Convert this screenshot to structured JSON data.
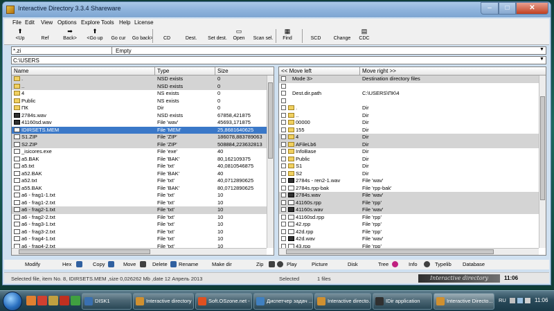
{
  "window": {
    "title": "Interactive Directory 3.3.4 Shareware",
    "min_glyph": "–",
    "max_glyph": "□",
    "close_glyph": "✕"
  },
  "menu": [
    "File",
    "Edit",
    "View",
    "Options",
    "Explore",
    "Tools",
    "Help",
    "License"
  ],
  "toolbar": {
    "buttons": [
      {
        "label": "<Up",
        "icon": "up-arrow-icon",
        "glyph": "⬆"
      },
      {
        "label": "Ref",
        "icon": "refresh-icon",
        "glyph": ""
      },
      {
        "label": "Back>",
        "icon": "back-arrow-icon",
        "glyph": "➡"
      },
      {
        "label": "<Go up",
        "icon": "go-up-arrow-icon",
        "glyph": "⬆"
      },
      {
        "label": "Go cur",
        "icon": "go-current-icon",
        "glyph": ""
      },
      {
        "label": "Go back>",
        "icon": "go-back-icon",
        "glyph": ""
      },
      {
        "label": "CD",
        "icon": "cd-icon",
        "glyph": ""
      },
      {
        "label": "Dest.",
        "icon": "destination-icon",
        "glyph": ""
      },
      {
        "label": "Set dest.",
        "icon": "set-destination-icon",
        "glyph": ""
      },
      {
        "label": "Open",
        "icon": "open-icon",
        "glyph": "▭"
      },
      {
        "label": "Scan sel.",
        "icon": "scan-icon",
        "glyph": ""
      },
      {
        "label": "Find",
        "icon": "find-icon",
        "glyph": "▦"
      },
      {
        "label": "SCD",
        "icon": "scd-icon",
        "glyph": ""
      },
      {
        "label": "Change",
        "icon": "change-icon",
        "glyph": ""
      },
      {
        "label": "CDC",
        "icon": "cdc-icon",
        "glyph": "▤"
      }
    ]
  },
  "mask": {
    "value": "*.zi",
    "status": "Empty",
    "dropdown_glyph": "▼"
  },
  "path": {
    "value": "C:\\USERS",
    "dropdown_glyph": "▼"
  },
  "left_panel": {
    "headers": {
      "name": "Name",
      "type": "Type",
      "size": "Size"
    },
    "rows": [
      {
        "name": ".",
        "type": "NSD exists",
        "size": "0",
        "icon": "folder",
        "style": "gray"
      },
      {
        "name": "..",
        "type": "NSD exists",
        "size": "0",
        "icon": "folder",
        "style": "gray"
      },
      {
        "name": "4",
        "type": "NS exists",
        "size": "0",
        "icon": "folder",
        "style": "white"
      },
      {
        "name": "Public",
        "type": "NS exists",
        "size": "0",
        "icon": "folder",
        "style": "white"
      },
      {
        "name": "ПК",
        "type": "Dir",
        "size": "0",
        "icon": "folder",
        "style": "white"
      },
      {
        "name": "2784s.wav",
        "type": "NSD exists",
        "size": "67858,421875",
        "icon": "wav",
        "style": "white"
      },
      {
        "name": "41160sd.wav",
        "type": "File 'wav'",
        "size": "45693,171875",
        "icon": "wav",
        "style": "white"
      },
      {
        "name": "IDIRSETS.MEM",
        "type": "File 'MEM'",
        "size": "25,8681640625",
        "icon": "file",
        "style": "sel"
      },
      {
        "name": "S1.ZIP",
        "type": "File 'ZIP'",
        "size": "186078,883789063",
        "icon": "file",
        "style": "gray"
      },
      {
        "name": "S2.ZIP",
        "type": "File 'ZIP'",
        "size": "508884,223632813",
        "icon": "file",
        "style": "gray"
      },
      {
        "name": "_isicores.exe",
        "type": "File 'exe'",
        "size": "40",
        "icon": "file",
        "style": "white"
      },
      {
        "name": "a5.BAK",
        "type": "File 'BAK'",
        "size": "80,162109375",
        "icon": "file",
        "style": "white"
      },
      {
        "name": "a5.txt",
        "type": "File 'txt'",
        "size": "40,0810546875",
        "icon": "file",
        "style": "white"
      },
      {
        "name": "a52.BAK",
        "type": "File 'BAK'",
        "size": "40",
        "icon": "file",
        "style": "white"
      },
      {
        "name": "a52.txt",
        "type": "File 'txt'",
        "size": "40,0712890625",
        "icon": "file",
        "style": "white"
      },
      {
        "name": "a55.BAK",
        "type": "File 'BAK'",
        "size": "80,0712890625",
        "icon": "file",
        "style": "white"
      },
      {
        "name": "a6 - frag1-1.txt",
        "type": "File 'txt'",
        "size": "10",
        "icon": "file",
        "style": "white"
      },
      {
        "name": "a6 - frag1-2.txt",
        "type": "File 'txt'",
        "size": "10",
        "icon": "file",
        "style": "white"
      },
      {
        "name": "a6 - frag2-1.txt",
        "type": "File 'txt'",
        "size": "10",
        "icon": "file",
        "style": "gray"
      },
      {
        "name": "a6 - frag2-2.txt",
        "type": "File 'txt'",
        "size": "10",
        "icon": "file",
        "style": "white"
      },
      {
        "name": "a6 - frag3-1.txt",
        "type": "File 'txt'",
        "size": "10",
        "icon": "file",
        "style": "white"
      },
      {
        "name": "a6 - frag3-2.txt",
        "type": "File 'txt'",
        "size": "10",
        "icon": "file",
        "style": "white"
      },
      {
        "name": "a6 - frag4-1.txt",
        "type": "File 'txt'",
        "size": "10",
        "icon": "file",
        "style": "white"
      },
      {
        "name": "a6 - frag4-2.txt",
        "type": "File 'txt'",
        "size": "10",
        "icon": "file",
        "style": "white"
      }
    ]
  },
  "right_panel": {
    "headers": {
      "left": "<< Move left",
      "right": "Move right >>"
    },
    "rows": [
      {
        "name": "Mode 3>",
        "type": "Destination directory files",
        "icon": "none",
        "style": "gray"
      },
      {
        "name": "",
        "type": "",
        "icon": "none",
        "style": "white"
      },
      {
        "name": "Dest.dir.path",
        "type": "C:\\USERS\\ПК\\4",
        "icon": "none",
        "style": "white"
      },
      {
        "name": "",
        "type": "",
        "icon": "none",
        "style": "white"
      },
      {
        "name": ".",
        "type": "Dir",
        "icon": "folder",
        "style": "white"
      },
      {
        "name": "..",
        "type": "Dir",
        "icon": "folder",
        "style": "white"
      },
      {
        "name": "00000",
        "type": "Dir",
        "icon": "folder",
        "style": "white"
      },
      {
        "name": "155",
        "type": "Dir",
        "icon": "folder",
        "style": "white"
      },
      {
        "name": "4",
        "type": "Dir",
        "icon": "folder",
        "style": "gray"
      },
      {
        "name": "AFileLb6",
        "type": "Dir",
        "icon": "folder",
        "style": "gray"
      },
      {
        "name": "InfoBase",
        "type": "Dir",
        "icon": "folder",
        "style": "white"
      },
      {
        "name": "Public",
        "type": "Dir",
        "icon": "folder",
        "style": "white"
      },
      {
        "name": "S1",
        "type": "Dir",
        "icon": "folder",
        "style": "white"
      },
      {
        "name": "S2",
        "type": "Dir",
        "icon": "folder",
        "style": "white"
      },
      {
        "name": "2784s - ren2-1.wav",
        "type": "File 'wav'",
        "icon": "wav",
        "style": "white"
      },
      {
        "name": "2784s.rpp-bak",
        "type": "File 'rpp-bak'",
        "icon": "file",
        "style": "white"
      },
      {
        "name": "2784s.wav",
        "type": "File 'wav'",
        "icon": "wav",
        "style": "gray"
      },
      {
        "name": "41160s.rpp",
        "type": "File 'rpp'",
        "icon": "file",
        "style": "gray"
      },
      {
        "name": "41160s.wav",
        "type": "File 'wav'",
        "icon": "wav",
        "style": "gray"
      },
      {
        "name": "41160sd.rpp",
        "type": "File 'rpp'",
        "icon": "file",
        "style": "white"
      },
      {
        "name": "42.rpp",
        "type": "File 'rpp'",
        "icon": "file",
        "style": "white"
      },
      {
        "name": "42d.rpp",
        "type": "File 'rpp'",
        "icon": "file",
        "style": "white"
      },
      {
        "name": "42d.wav",
        "type": "File 'wav'",
        "icon": "wav",
        "style": "white"
      },
      {
        "name": "43.rpp",
        "type": "File 'rpp'",
        "icon": "file",
        "style": "white"
      }
    ]
  },
  "funcbar": {
    "left": [
      "Modify",
      "Hex",
      "Copy",
      "Move",
      "Delete",
      "Rename",
      "Make dir",
      "Zip"
    ],
    "right": [
      "Play",
      "Picture",
      "Disk",
      "Tree",
      "Info",
      "Typelib",
      "Database"
    ]
  },
  "status": {
    "left": "Selected file, item No. 8, IDIRSETS.MEM ,size 0,026262 Mb ,date 12 Апрель 2013",
    "selected": "Selected",
    "count": "1 files",
    "logo": "Interactive directory",
    "time": "11:06"
  },
  "taskbar": {
    "tasks": [
      {
        "label": "DISK1",
        "color": "#3a70b0"
      },
      {
        "label": "Interactive directory",
        "color": "#d09030"
      },
      {
        "label": "Soft.OSzone.net - ...",
        "color": "#e05020"
      },
      {
        "label": "Диспетчер задач ...",
        "color": "#4080c0"
      },
      {
        "label": "Interactive directo...",
        "color": "#d09030"
      },
      {
        "label": "IDir application",
        "color": "#303030"
      },
      {
        "label": "Interactive Directo...",
        "color": "#d09030"
      }
    ],
    "lang": "RU",
    "time": "11:06"
  },
  "colors": {
    "selection": "#3a78c8",
    "gray_row": "#d4d4d4",
    "titlebar": "#8fb4dc",
    "taskbar": "#2a4a5a"
  }
}
